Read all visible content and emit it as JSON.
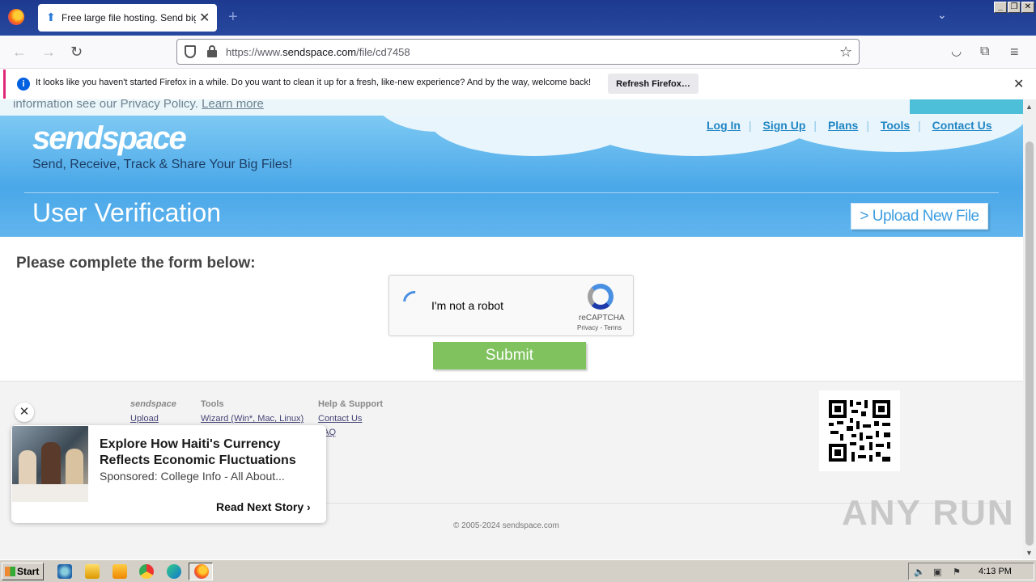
{
  "browser": {
    "tab_title": "Free large file hosting. Send big fil",
    "url_prefix": "https://www.",
    "url_domain": "sendspace.com",
    "url_path": "/file/cd7458",
    "notification": "It looks like you haven't started Firefox in a while. Do you want to clean it up for a fresh, like-new experience? And by the way, welcome back!",
    "refresh_label": "Refresh Firefox…"
  },
  "cookie_bar": {
    "text": "information see our Privacy Policy.",
    "learn_more": "Learn more"
  },
  "header": {
    "logo": "sendspace",
    "tagline": "Send, Receive, Track & Share Your Big Files!",
    "nav": [
      "Log In",
      "Sign Up",
      "Plans",
      "Tools",
      "Contact Us"
    ],
    "page_title": "User Verification",
    "upload_button": "> Upload New File"
  },
  "form": {
    "heading": "Please complete the form below:",
    "captcha_label": "I'm not a robot",
    "captcha_brand": "reCAPTCHA",
    "captcha_links": "Privacy - Terms",
    "submit_label": "Submit"
  },
  "footer": {
    "col1_heading": "sendspace",
    "col1_links": [
      "Upload"
    ],
    "col2_heading": "Tools",
    "col2_links": [
      "Wizard (Win*, Mac, Linux)"
    ],
    "col3_heading": "Help & Support",
    "col3_links": [
      "Contact Us",
      "FAQ"
    ],
    "copyright": "© 2005-2024 sendspace.com",
    "watermark": "ANY RUN"
  },
  "ad": {
    "headline": "Explore How Haiti's Currency Reflects Economic Fluctuations",
    "sponsor": "Sponsored: College Info - All About...",
    "read_next": "Read Next Story"
  },
  "taskbar": {
    "start_label": "Start",
    "clock": "4:13 PM"
  },
  "colors": {
    "accent_blue": "#4aa7e8",
    "submit_green": "#7fc25e",
    "link_blue": "#1f86c4"
  }
}
